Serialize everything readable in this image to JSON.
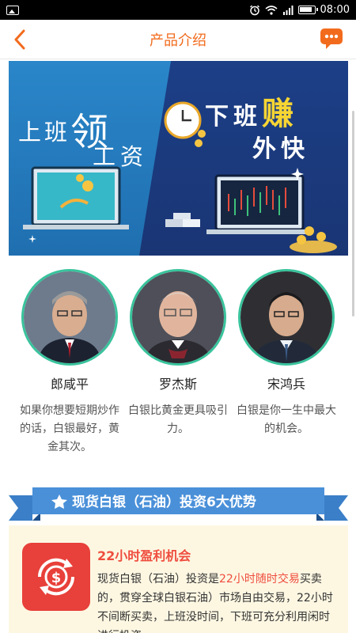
{
  "status_bar": {
    "time": "08:00"
  },
  "header": {
    "title": "产品介绍"
  },
  "banner": {
    "left_line1_a": "上班",
    "left_line1_b": "领",
    "left_line2": "工资",
    "right_line1_a": "下班",
    "right_line1_b": "赚",
    "right_line2": "外快"
  },
  "experts": [
    {
      "name": "郎咸平",
      "quote": "如果你想要短期炒作的话，白银最好，黄金其次。"
    },
    {
      "name": "罗杰斯",
      "quote": "白银比黄金更具吸引力。"
    },
    {
      "name": "宋鸿兵",
      "quote": "白银是你一生中最大的机会。"
    }
  ],
  "section": {
    "title": "现货白银（石油）投资6大优势"
  },
  "advantage": {
    "title": "22小时盈利机会",
    "text_a": "现货白银（石油）投资是",
    "text_highlight": "22小时随时交易",
    "text_b": "买卖的，贯穿全球白银石油）市场自由交易，22小时不间断买卖，上班没时间，下班可充分利用闲时进行投资。"
  },
  "colors": {
    "accent": "#f26b1d",
    "ribbon": "#4a90d9",
    "teal": "#39c39c",
    "red": "#ef4d3e"
  }
}
